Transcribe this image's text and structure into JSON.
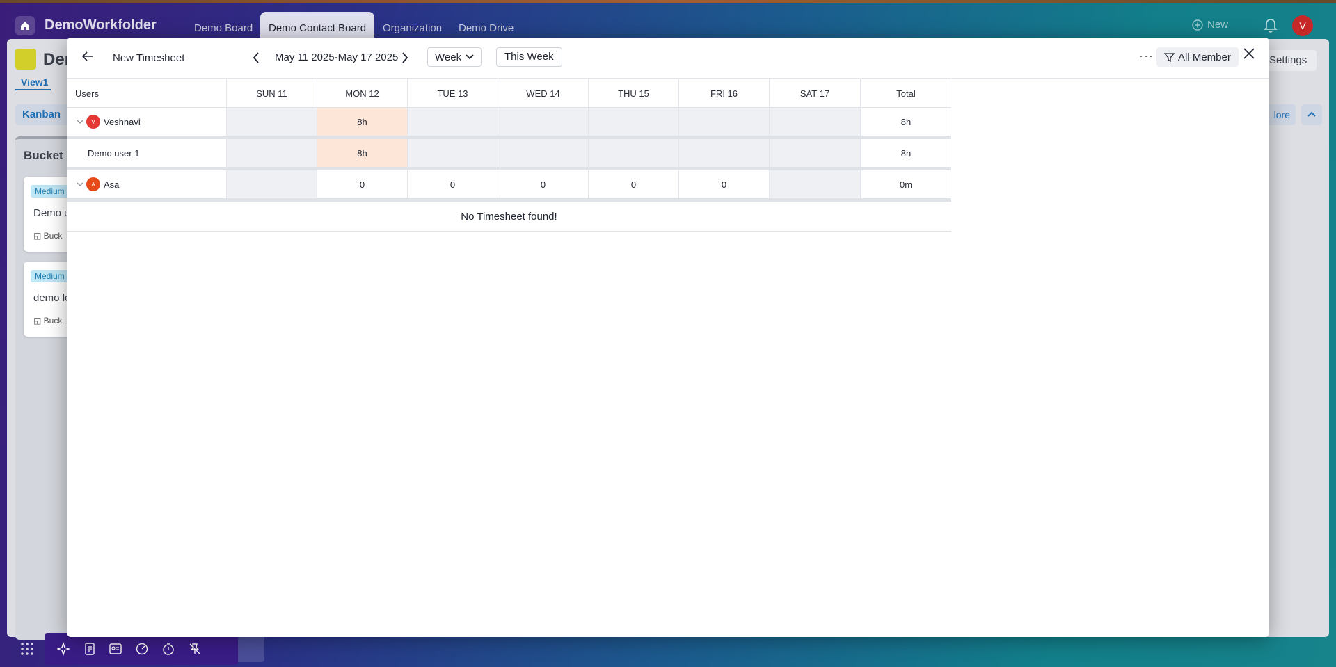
{
  "app": {
    "title": "DemoWorkfolder",
    "tabs": [
      "Demo Board",
      "Demo Contact Board",
      "Organization",
      "Demo Drive"
    ],
    "new_label": "New",
    "avatar_initial": "V"
  },
  "background": {
    "board_title": "Der",
    "settings_label": "Settings",
    "view_label": "View1",
    "kanban_label": "Kanban",
    "more_label": "lore",
    "column_title": "Bucket",
    "cards": [
      {
        "badge": "Medium",
        "text": "Demo u",
        "meta": "Buck"
      },
      {
        "badge": "Medium",
        "text": "demo le",
        "meta": "Buck"
      }
    ]
  },
  "modal": {
    "title": "New Timesheet",
    "date_range": "May 11 2025-May 17 2025",
    "period_label": "Week",
    "this_week_label": "This Week",
    "filter_label": "All Member",
    "columns": [
      "Users",
      "SUN 11",
      "MON 12",
      "TUE 13",
      "WED 14",
      "THU 15",
      "FRI 16",
      "SAT 17",
      "Total"
    ],
    "rows": [
      {
        "name": "Veshnavi",
        "avatar": "V",
        "avatar_color": "#e53935",
        "expandable": true,
        "cells": [
          "",
          "8h",
          "",
          "",
          "",
          "",
          ""
        ],
        "total": "8h"
      },
      {
        "name": "Demo user 1",
        "avatar": "",
        "expandable": false,
        "cells": [
          "",
          "8h",
          "",
          "",
          "",
          "",
          ""
        ],
        "total": "8h"
      },
      {
        "name": "Asa",
        "avatar": "A",
        "avatar_color": "#e64a19",
        "expandable": true,
        "cells": [
          "",
          "0",
          "0",
          "0",
          "0",
          "0",
          ""
        ],
        "total": "0m"
      }
    ],
    "empty_message": "No Timesheet found!"
  },
  "colors": {
    "weekend_cell": "#eef0f4",
    "highlight_cell": "#fde5d8",
    "avatar_top": "#c62828"
  }
}
